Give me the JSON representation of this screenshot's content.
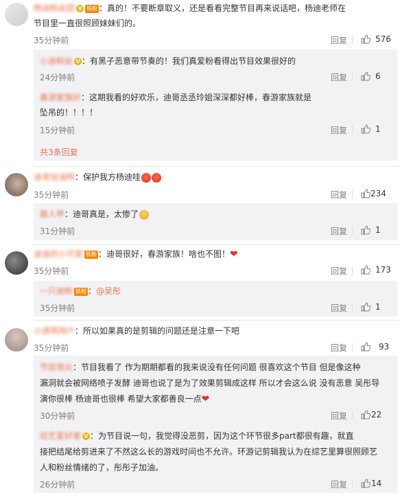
{
  "ui": {
    "reply": "回复"
  },
  "comments": [
    {
      "name": "杨迪粉丝团",
      "fan": "铁粉",
      "text1": "：真的！不要断章取义，还是看看完整节目再来说话吧，杨迪老师在",
      "text2": "节目里一直很照顾妹妹们的。",
      "time": "35分钟前",
      "likes": "576",
      "subs": [
        {
          "name": "小迪粉丝",
          "text": "：有黑子恶意带节奏的！我们真爱粉看得出节目效果很好的",
          "time": "24分钟前",
          "likes": "6"
        },
        {
          "name": "春游家族好",
          "text1": "：这期我看的好欢乐，迪哥丞丞玲姐深深都好棒，春游家族就是",
          "text2": "坠吊的！！！！",
          "time": "15分钟前",
          "likes": "1"
        }
      ],
      "more": "共3条回复"
    },
    {
      "name": "迪哥加油鸭",
      "text": "：保护我方杨迪哇",
      "time": "35分钟前",
      "likes": "234",
      "subs": [
        {
          "name": "路人甲",
          "text": "：迪哥真是，太惨了",
          "time": "31分钟前",
          "likes": "1"
        }
      ]
    },
    {
      "name": "迪迪的小可爱",
      "fan": "铁粉",
      "text": "：迪哥很好，春游家族！啥也不图！",
      "time": "35分钟前",
      "likes": "173",
      "subs": [
        {
          "name": "一只迪粉",
          "fan": "铁粉",
          "text": "：",
          "mention": "@吴彤",
          "time": "35分钟前",
          "likes": "1"
        }
      ]
    },
    {
      "name": "小透明用户",
      "text": "：所以如果真的是剪辑的问题还是注意一下吧",
      "time": "35分钟前",
      "likes": "93",
      "subs": [
        {
          "name": "节目观众",
          "text1": "：节目我看了 作为期期都看的我来说没有任何问题 很喜欢这个节目 但是像这种",
          "text2": "漏洞就会被网络喷子发酵 迪哥也说了是为了效果剪辑成这样 所以才会这么说 没有恶意 吴彤导",
          "text3": "演你很棒 杨迪哥也很棒 希望大家都善良一点",
          "time": "30分钟前",
          "likes": "22"
        },
        {
          "name": "综艺爱好者",
          "text1": "：为节目说一句，我觉得没恶剪，因为这个环节很多part都很有趣，就直",
          "text2": "接把结尾给剪进来了不然这么长的游戏时间也不允许。环游记剪辑我认为在综艺里算很照顾艺",
          "text3": "人和粉丝情绪的了，彤彤子加油。",
          "time": "26分钟前",
          "likes": "14"
        }
      ]
    }
  ]
}
